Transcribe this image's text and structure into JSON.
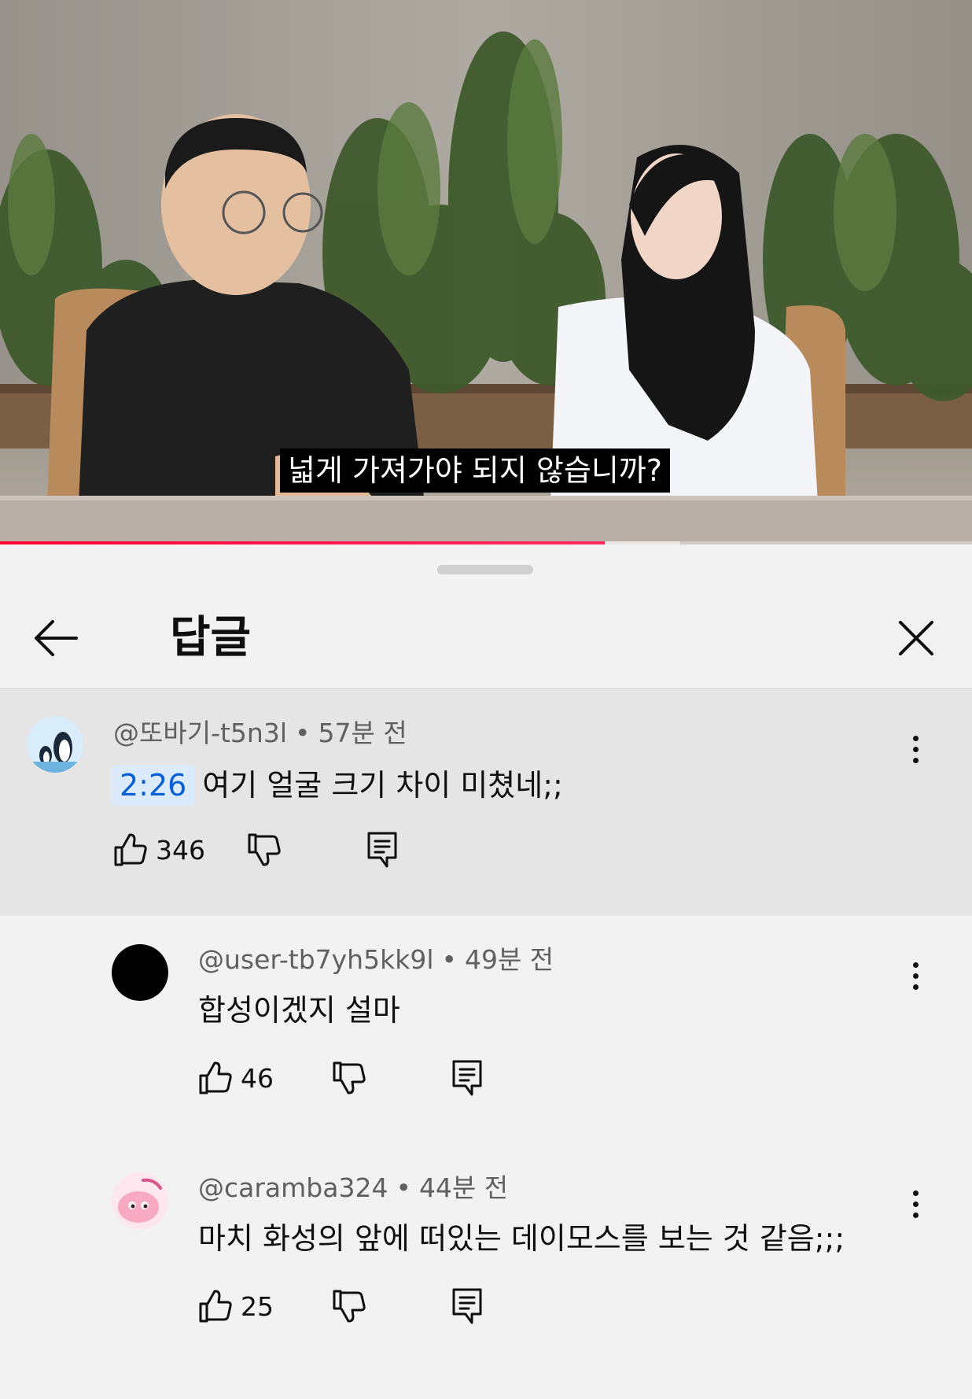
{
  "video": {
    "subtitle": "넓게 가져가야 되지 않습니까?",
    "progress_fraction": 0.622,
    "progress_color": "#ff0033"
  },
  "sheet": {
    "title": "답글",
    "back_icon": "arrow-left-icon",
    "close_icon": "close-icon"
  },
  "parent_comment": {
    "author": "@또바기-t5n3l",
    "age": "57분 전",
    "timestamp_link": "2:26",
    "text": "여기 얼굴 크기 차이 미쳤네;;",
    "likes": "346",
    "background": "#e5e5e5"
  },
  "replies": [
    {
      "author": "@user-tb7yh5kk9l",
      "age": "49분 전",
      "text": "합성이겠지 설마",
      "likes": "46"
    },
    {
      "author": "@caramba324",
      "age": "44분 전",
      "text": "마치 화성의 앞에 떠있는 데이모스를 보는 것 같음;;;",
      "likes": "25"
    }
  ],
  "separator": "•",
  "colors": {
    "link": "#065fd4",
    "secondary_text": "#606060",
    "sheet_bg": "#f2f2f2"
  }
}
